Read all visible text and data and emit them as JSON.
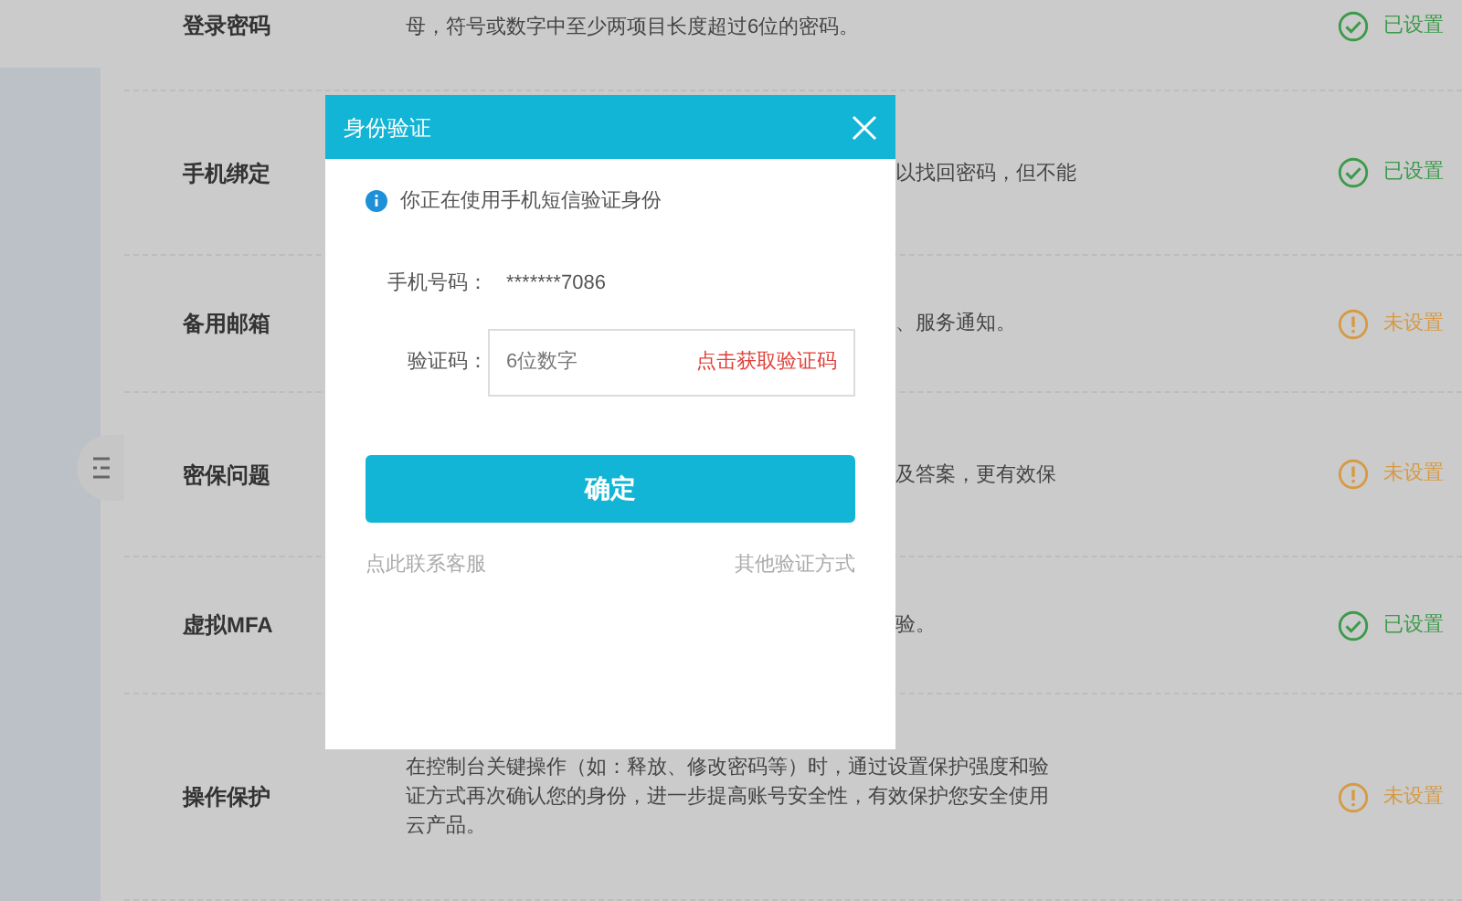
{
  "rows": [
    {
      "title": "登录密码",
      "description": "母，符号或数字中至少两项目长度超过6位的密码。",
      "hidden_by_dialog": false,
      "status": {
        "kind": "set",
        "label": "已设置"
      }
    },
    {
      "title": "手机绑定",
      "description": "以找回密码，但不能",
      "hidden_by_dialog": true,
      "status": {
        "kind": "set",
        "label": "已设置"
      }
    },
    {
      "title": "备用邮箱",
      "description": "、服务通知。",
      "hidden_by_dialog": true,
      "status": {
        "kind": "unset",
        "label": "未设置"
      }
    },
    {
      "title": "密保问题",
      "description": "及答案，更有效保",
      "hidden_by_dialog": true,
      "status": {
        "kind": "unset",
        "label": "未设置"
      }
    },
    {
      "title": "虚拟MFA",
      "description": "验。",
      "hidden_by_dialog": true,
      "status": {
        "kind": "set",
        "label": "已设置"
      }
    },
    {
      "title": "操作保护",
      "description": "在控制台关键操作（如：释放、修改密码等）时，通过设置保护强度和验证方式再次确认您的身份，进一步提高账号安全性，有效保护您安全使用云产品。",
      "hidden_by_dialog": false,
      "status": {
        "kind": "unset",
        "label": "未设置"
      }
    }
  ],
  "dialog": {
    "title": "身份验证",
    "notice": "你正在使用手机短信验证身份",
    "phone_label": "手机号码：",
    "phone_value": "*******7086",
    "code_label": "验证码：",
    "code_placeholder": "6位数字",
    "get_code": "点击获取验证码",
    "confirm": "确定",
    "contact_link": "点此联系客服",
    "other_link": "其他验证方式"
  }
}
